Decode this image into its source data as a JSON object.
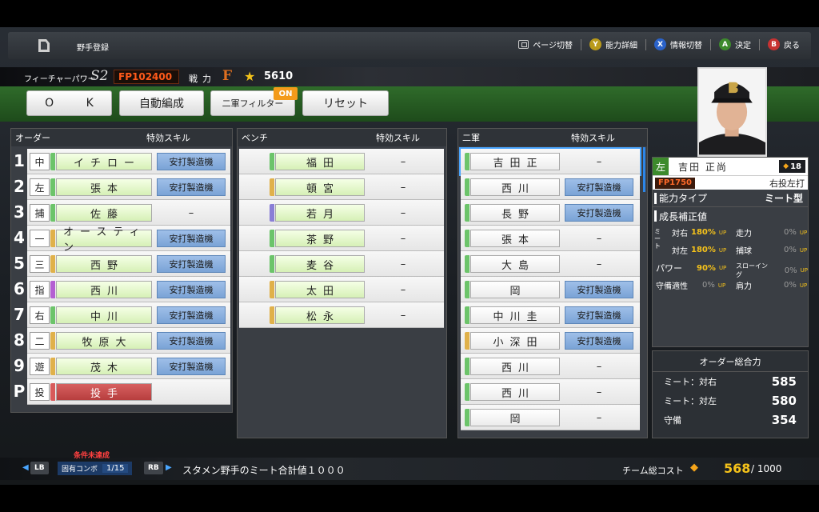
{
  "header": {
    "title": "野手登録",
    "hints": [
      {
        "key": "⧉",
        "label": "ページ切替",
        "color": "#2b2f34"
      },
      {
        "key": "Y",
        "label": "能力詳細",
        "color": "#b99a1a"
      },
      {
        "key": "X",
        "label": "情報切替",
        "color": "#2a62c9"
      },
      {
        "key": "A",
        "label": "決定",
        "color": "#3d8a2c"
      },
      {
        "key": "B",
        "label": "戻る",
        "color": "#c73232"
      }
    ]
  },
  "status": {
    "future_label": "フィーチャーパワー",
    "future_rank": "S2",
    "fp": "FP102400",
    "senryoku_label": "戦力",
    "senryoku_grade": "F",
    "power": "5610"
  },
  "buttons": {
    "ok": "O K",
    "auto": "自動編成",
    "filter": "二軍フィルター",
    "filter_badge": "ON",
    "reset": "リセット"
  },
  "order": {
    "header_left": "オーダー",
    "header_skill": "特効スキル",
    "rows": [
      {
        "num": "1",
        "pos": "中",
        "stripe": "#6cc46a",
        "name": "イチロー",
        "skill": "安打製造機"
      },
      {
        "num": "2",
        "pos": "左",
        "stripe": "#6cc46a",
        "name": "張本",
        "skill": "安打製造機"
      },
      {
        "num": "3",
        "pos": "捕",
        "stripe": "#6cc46a",
        "name": "佐藤",
        "skill": "–"
      },
      {
        "num": "4",
        "pos": "一",
        "stripe": "#e0b14a",
        "name": "オースティン",
        "skill": "安打製造機"
      },
      {
        "num": "5",
        "pos": "三",
        "stripe": "#e0b14a",
        "name": "西野",
        "skill": "安打製造機"
      },
      {
        "num": "6",
        "pos": "指",
        "stripe": "#b45fd2",
        "name": "西川",
        "skill": "安打製造機"
      },
      {
        "num": "7",
        "pos": "右",
        "stripe": "#6cc46a",
        "name": "中川",
        "skill": "安打製造機"
      },
      {
        "num": "8",
        "pos": "二",
        "stripe": "#e0b14a",
        "name": "牧原大",
        "skill": "安打製造機"
      },
      {
        "num": "9",
        "pos": "遊",
        "stripe": "#e0b14a",
        "name": "茂木",
        "skill": "安打製造機"
      },
      {
        "num": "P",
        "pos": "投",
        "stripe": "#d85a5a",
        "name": "投手",
        "skill": ""
      }
    ]
  },
  "bench": {
    "header_left": "ベンチ",
    "header_skill": "特効スキル",
    "rows": [
      {
        "stripe": "#6cc46a",
        "name": "福田",
        "skill": "–"
      },
      {
        "stripe": "#e0b14a",
        "name": "頓宮",
        "skill": "–"
      },
      {
        "stripe": "#8a7fd6",
        "name": "若月",
        "skill": "–"
      },
      {
        "stripe": "#6cc46a",
        "name": "茶野",
        "skill": "–"
      },
      {
        "stripe": "#6cc46a",
        "name": "麦谷",
        "skill": "–"
      },
      {
        "stripe": "#e0b14a",
        "name": "太田",
        "skill": "–"
      },
      {
        "stripe": "#e0b14a",
        "name": "松永",
        "skill": "–"
      }
    ]
  },
  "farm": {
    "header_left": "二軍",
    "header_skill": "特効スキル",
    "rows": [
      {
        "stripe": "#6cc46a",
        "name": "吉田正",
        "skill": "–"
      },
      {
        "stripe": "#6cc46a",
        "name": "西川",
        "skill": "安打製造機"
      },
      {
        "stripe": "#6cc46a",
        "name": "長野",
        "skill": "安打製造機"
      },
      {
        "stripe": "#6cc46a",
        "name": "張本",
        "skill": "–"
      },
      {
        "stripe": "#6cc46a",
        "name": "大島",
        "skill": "–"
      },
      {
        "stripe": "#6cc46a",
        "name": "岡",
        "skill": "安打製造機"
      },
      {
        "stripe": "#6cc46a",
        "name": "中川圭",
        "skill": "安打製造機"
      },
      {
        "stripe": "#e0b14a",
        "name": "小深田",
        "skill": "安打製造機"
      },
      {
        "stripe": "#6cc46a",
        "name": "西川",
        "skill": "–"
      },
      {
        "stripe": "#6cc46a",
        "name": "西川",
        "skill": "–"
      },
      {
        "stripe": "#6cc46a",
        "name": "岡",
        "skill": "–"
      }
    ]
  },
  "player": {
    "hand_pos": "左",
    "name": "吉田 正尚",
    "level": "18",
    "fp": "FP1750",
    "hands": "右投左打",
    "type_label": "能力タイプ",
    "type_value": "ミート型",
    "growth_label": "成長補正値",
    "meet_label": "ミート",
    "vs_right_label": "対右",
    "vs_right_value": "180%",
    "vs_left_label": "対左",
    "vs_left_value": "180%",
    "up": "UP",
    "run_label": "走力",
    "catch_label": "捕球",
    "swing_label": "スローイング",
    "power_label": "パワー",
    "power_value": "90%",
    "shoulder_label": "肩力",
    "fielding_label": "守備適性",
    "zero": "0%"
  },
  "total": {
    "title": "オーダー総合力",
    "rows": [
      {
        "label": "ミート：対右",
        "value": "585"
      },
      {
        "label": "ミート：対左",
        "value": "580"
      },
      {
        "label": "守備",
        "value": "354"
      }
    ]
  },
  "bottom": {
    "warning": "条件未達成",
    "lb": "LB",
    "combo_label": "固有コンボ",
    "combo_count": "1/15",
    "rb": "RB",
    "mission": "スタメン野手のミート合計値１０００",
    "cost_label": "チーム総コスト",
    "cost_value": "568",
    "cost_max": "/ 1000"
  }
}
